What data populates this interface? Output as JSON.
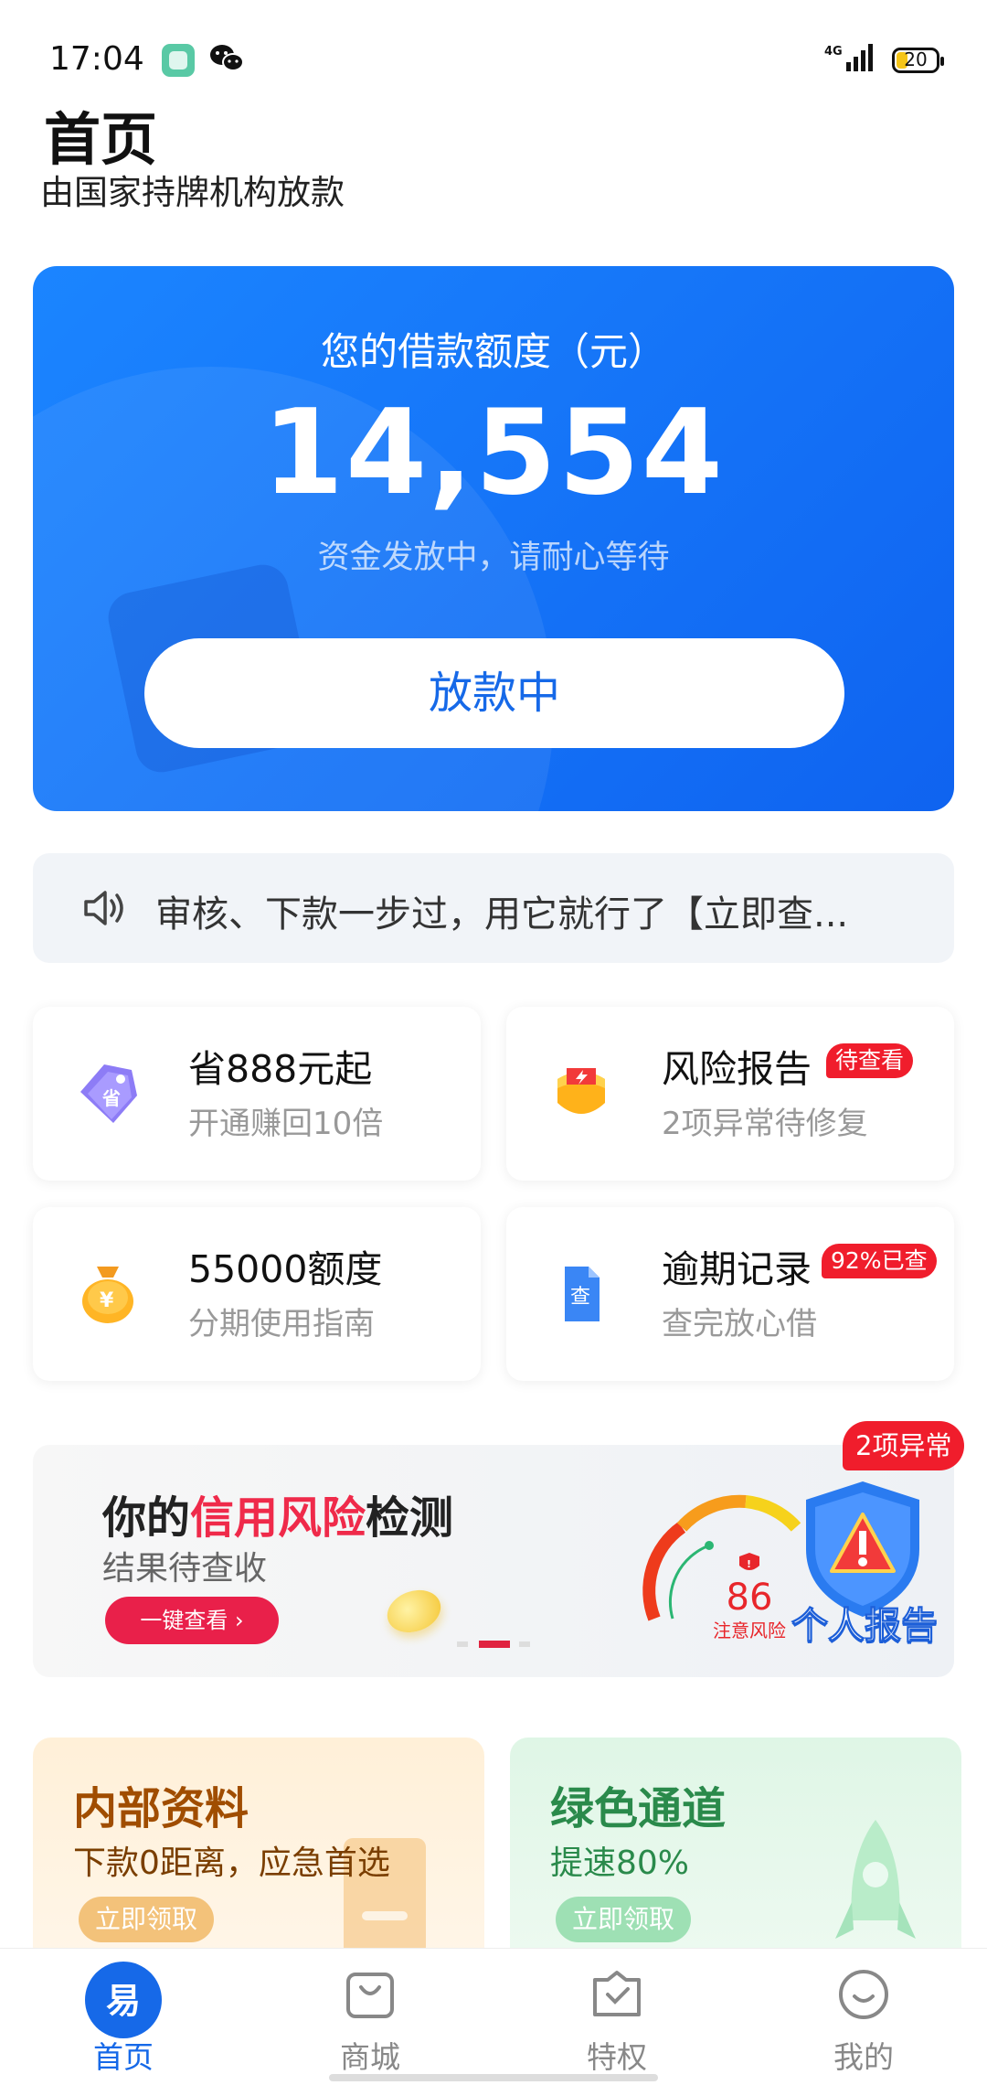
{
  "status_bar": {
    "time": "17:04",
    "network": "4G",
    "battery": "20"
  },
  "header": {
    "title": "首页",
    "subtitle": "由国家持牌机构放款"
  },
  "hero": {
    "label": "您的借款额度（元）",
    "amount": "14,554",
    "note": "资金发放中，请耐心等待",
    "button": "放款中"
  },
  "notice": {
    "text": "审核、下款一步过，用它就行了【立即查..."
  },
  "cards": [
    {
      "title": "省888元起",
      "sub": "开通赚回10倍",
      "icon": "discount-tag-icon",
      "badge": ""
    },
    {
      "title": "风险报告",
      "sub": "2项异常待修复",
      "icon": "risk-report-icon",
      "badge": "待查看"
    },
    {
      "title": "55000额度",
      "sub": "分期使用指南",
      "icon": "money-bag-icon",
      "badge": ""
    },
    {
      "title": "逾期记录",
      "sub": "查完放心借",
      "icon": "search-document-icon",
      "badge": "92%已查"
    }
  ],
  "banner": {
    "title_pre": "你的",
    "title_highlight": "信用风险",
    "title_post": "检测",
    "sub": "结果待查收",
    "button": "一键查看 ›",
    "gauge_score": "86",
    "gauge_label": "注意风险",
    "report_label": "个人报告",
    "badge": "2项异常",
    "active_slide": 2,
    "slide_count": 3
  },
  "promos": [
    {
      "title": "内部资料",
      "sub": "下款0距离，应急首选",
      "button": "立即领取",
      "title_color": "#a04d00",
      "sub_color": "#7a3e00",
      "button_color": "#f3c27a"
    },
    {
      "title": "绿色通道",
      "sub": "提速80%",
      "button": "立即领取",
      "title_color": "#2a8a4b",
      "sub_color": "#2a8a4b",
      "button_color": "#9ee0b4"
    }
  ],
  "tabbar": [
    {
      "label": "首页",
      "icon": "home-icon",
      "active": true
    },
    {
      "label": "商城",
      "icon": "shopping-bag-icon",
      "active": false
    },
    {
      "label": "特权",
      "icon": "privilege-icon",
      "active": false
    },
    {
      "label": "我的",
      "icon": "profile-icon",
      "active": false
    }
  ],
  "colors": {
    "primary": "#1669e8",
    "alert": "#f01d2c"
  }
}
